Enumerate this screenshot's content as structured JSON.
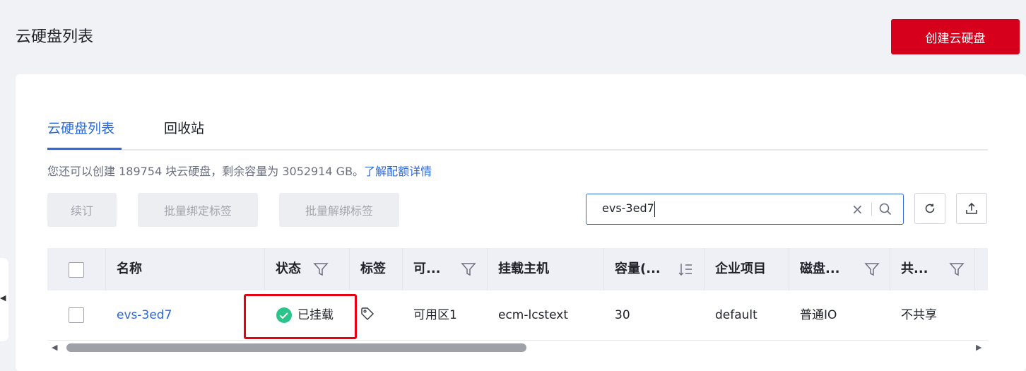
{
  "header": {
    "title": "云硬盘列表",
    "create_label": "创建云硬盘"
  },
  "tabs": [
    {
      "label": "云硬盘列表",
      "active": true
    },
    {
      "label": "回收站",
      "active": false
    }
  ],
  "quota": {
    "text": "您还可以创建 189754 块云硬盘，剩余容量为 3052914 GB。",
    "link": "了解配额详情"
  },
  "toolbar": {
    "renew": "续订",
    "bind_tags": "批量绑定标签",
    "unbind_tags": "批量解绑标签"
  },
  "search": {
    "value": "evs-3ed7"
  },
  "table": {
    "columns": {
      "name": "名称",
      "status": "状态",
      "tags": "标签",
      "az": "可...",
      "host": "挂载主机",
      "capacity": "容量(...",
      "project": "企业项目",
      "disk_type": "磁盘...",
      "shared": "共..."
    },
    "rows": [
      {
        "name": "evs-3ed7",
        "status": "已挂载",
        "az": "可用区1",
        "host": "ecm-lcstext",
        "capacity": "30",
        "project": "default",
        "disk_type": "普通IO",
        "shared": "不共享"
      }
    ]
  },
  "colors": {
    "accent": "#2d6ad8",
    "brand": "#d6001c",
    "success": "#2bc48a",
    "highlight": "#e60012"
  }
}
